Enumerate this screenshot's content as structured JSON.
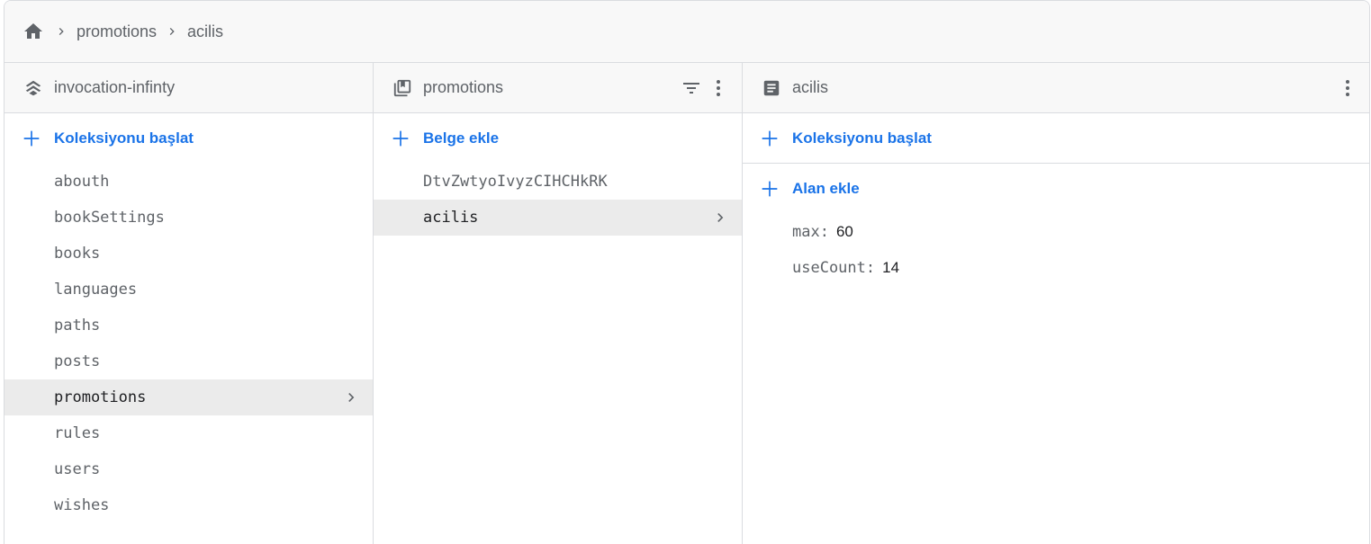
{
  "breadcrumb": {
    "items": [
      "promotions",
      "acilis"
    ]
  },
  "panels": {
    "root": {
      "title": "invocation-infinty",
      "add_label": "Koleksiyonu başlat",
      "collections": [
        "abouth",
        "bookSettings",
        "books",
        "languages",
        "paths",
        "posts",
        "promotions",
        "rules",
        "users",
        "wishes"
      ],
      "selected": "promotions"
    },
    "collection": {
      "title": "promotions",
      "add_label": "Belge ekle",
      "documents": [
        "DtvZwtyoIvyzCIHCHkRK",
        "acilis"
      ],
      "selected": "acilis"
    },
    "document": {
      "title": "acilis",
      "add_collection_label": "Koleksiyonu başlat",
      "add_field_label": "Alan ekle",
      "fields": [
        {
          "key": "max",
          "value": "60"
        },
        {
          "key": "useCount",
          "value": "14"
        }
      ]
    }
  },
  "colors": {
    "accent": "#1a73e8",
    "selected_bg": "#ebebeb",
    "header_bg": "#f8f8f8",
    "icon": "#5f6368"
  }
}
